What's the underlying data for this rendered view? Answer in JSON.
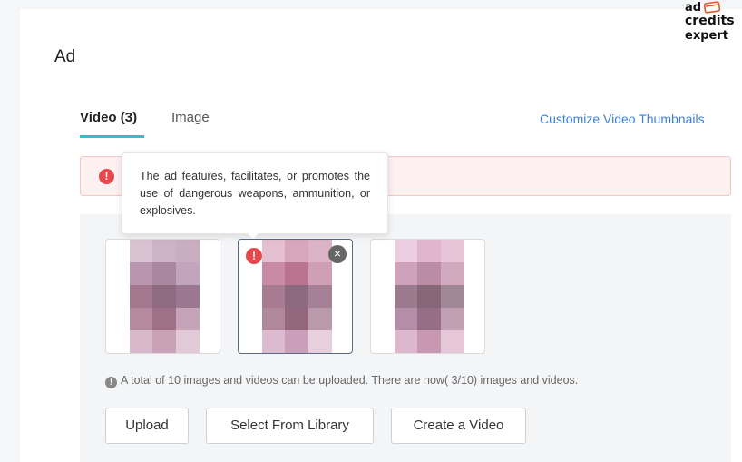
{
  "section": {
    "title": "Ad"
  },
  "tabs": [
    {
      "label": "Video (3)",
      "active": true
    },
    {
      "label": "Image",
      "active": false
    }
  ],
  "customize_link": "Customize Video Thumbnails",
  "alert": {
    "icon": "error-icon"
  },
  "tooltip": {
    "text": "The ad features, facilitates, or promotes the use of dangerous weapons, ammunition, or explosives."
  },
  "thumbnails": [
    {
      "status": "ok",
      "selected": false
    },
    {
      "status": "rejected",
      "selected": true,
      "has_close": true
    },
    {
      "status": "ok",
      "selected": false
    }
  ],
  "upload_note": "A total of 10 images and videos can be uploaded. There are now( 3/10) images and videos.",
  "buttons": {
    "upload": "Upload",
    "library": "Select From Library",
    "create": "Create a Video"
  },
  "logo": {
    "line1": "ad",
    "line2": "credits",
    "line3": "expert"
  },
  "colors": {
    "accent": "#27c3d0",
    "link": "#3d7fd6",
    "error": "#e5484d",
    "alert_bg": "#fdf0f0"
  }
}
